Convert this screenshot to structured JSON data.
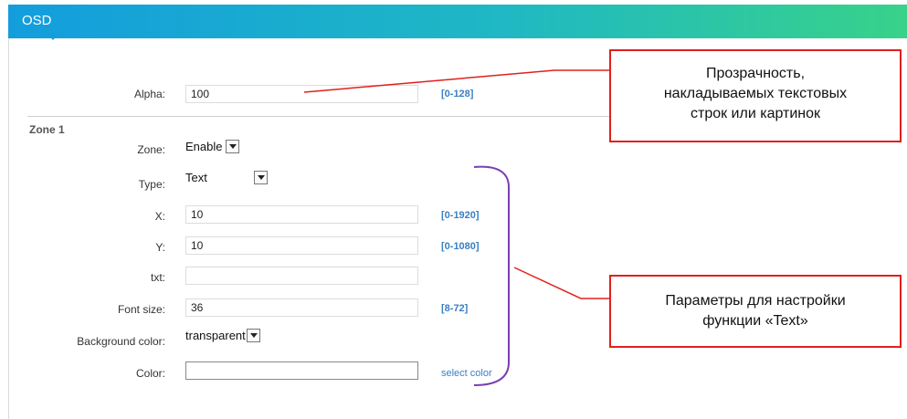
{
  "header": {
    "title": "OSD"
  },
  "alpha": {
    "label": "Alpha:",
    "value": "100",
    "range": "[0-128]"
  },
  "zone1": {
    "title": "Zone 1",
    "zone": {
      "label": "Zone:",
      "value": "Enable"
    },
    "type": {
      "label": "Type:",
      "value": "Text"
    },
    "x": {
      "label": "X:",
      "value": "10",
      "range": "[0-1920]"
    },
    "y": {
      "label": "Y:",
      "value": "10",
      "range": "[0-1080]"
    },
    "txt": {
      "label": "txt:",
      "value": ""
    },
    "font_size": {
      "label": "Font size:",
      "value": "36",
      "range": "[8-72]"
    },
    "background_color": {
      "label": "Background color:",
      "value": "transparent"
    },
    "color": {
      "label": "Color:",
      "value": "",
      "link": "select color"
    }
  },
  "annotations": {
    "alpha_note": [
      "Прозрачность,",
      "накладываемых текстовых",
      "строк или картинок"
    ],
    "text_params_note": [
      "Параметры для настройки",
      "функции «Text»"
    ]
  },
  "colors": {
    "header_start": "#139ddd",
    "header_end": "#38d28a",
    "range_text": "#3a7fc1",
    "callout_border": "#e0201c",
    "brace": "#7a3fb0"
  }
}
